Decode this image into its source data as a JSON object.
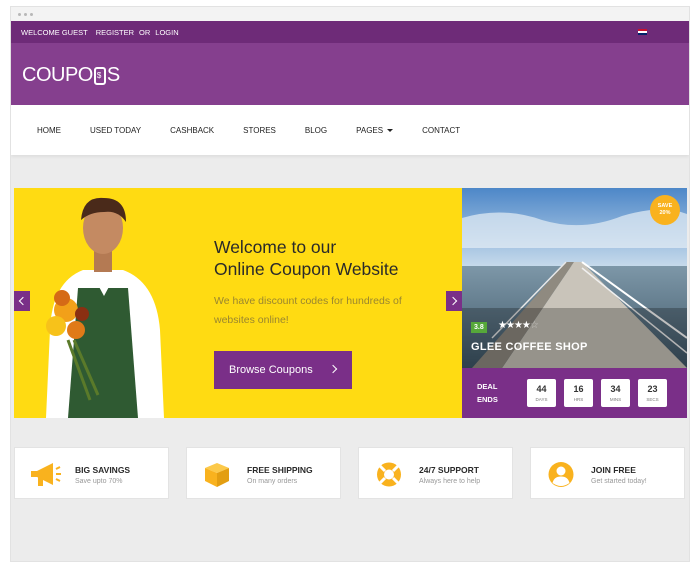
{
  "topbar": {
    "welcome": "Welcome Guest",
    "register": "Register",
    "or": "Or",
    "login": "Login"
  },
  "logo": {
    "text_left": "COUPO",
    "text_right": "S"
  },
  "nav": {
    "items": [
      "Home",
      "Used Today",
      "Cashback",
      "Stores",
      "Blog",
      "Pages",
      "Contact"
    ]
  },
  "hero": {
    "title_line1": "Welcome to our",
    "title_line2": "Online Coupon Website",
    "subtitle": "We have discount codes for hundreds of websites online!",
    "button": "Browse Coupons"
  },
  "deal": {
    "save_top": "Save",
    "save_pct": "20%",
    "rating": "3.8",
    "stars": 4,
    "shop_name": "GLEE COFFEE SHOP",
    "ends_label_1": "Deal",
    "ends_label_2": "Ends",
    "countdown": [
      {
        "value": "44",
        "unit": "Days"
      },
      {
        "value": "16",
        "unit": "Hrs"
      },
      {
        "value": "34",
        "unit": "Mins"
      },
      {
        "value": "23",
        "unit": "Secs"
      }
    ]
  },
  "features": [
    {
      "title": "Big Savings",
      "subtitle": "Save upto 70%",
      "icon": "megaphone-icon"
    },
    {
      "title": "Free Shipping",
      "subtitle": "On many orders",
      "icon": "box-icon"
    },
    {
      "title": "24/7 Support",
      "subtitle": "Always here to help",
      "icon": "lifebuoy-icon"
    },
    {
      "title": "Join Free",
      "subtitle": "Get started today!",
      "icon": "user-icon"
    }
  ],
  "colors": {
    "purple": "#853f8e",
    "dark_purple": "#6e2b78",
    "yellow": "#ffdb12",
    "accent": "#f9b21e"
  }
}
